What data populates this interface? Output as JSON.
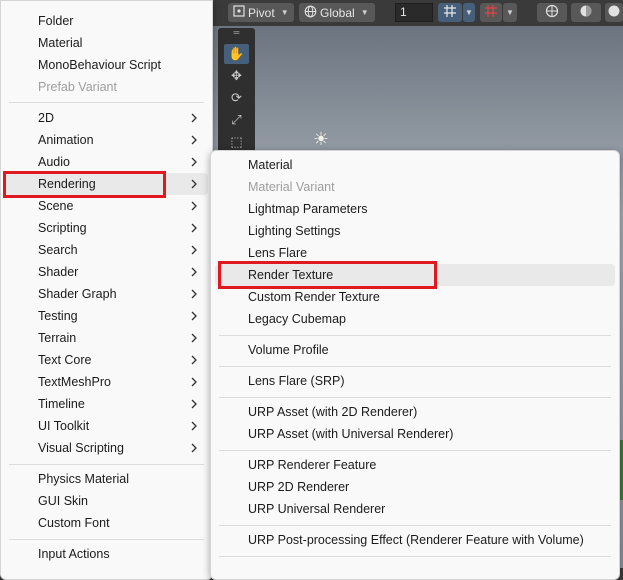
{
  "toolbar": {
    "pivot_label": "Pivot",
    "global_label": "Global",
    "snap_value": "1"
  },
  "main_menu": {
    "items": [
      {
        "label": "Folder",
        "has_submenu": false,
        "enabled": true
      },
      {
        "label": "Material",
        "has_submenu": false,
        "enabled": true
      },
      {
        "label": "MonoBehaviour Script",
        "has_submenu": false,
        "enabled": true
      },
      {
        "label": "Prefab Variant",
        "has_submenu": false,
        "enabled": false
      },
      {
        "label": "2D",
        "has_submenu": true,
        "enabled": true
      },
      {
        "label": "Animation",
        "has_submenu": true,
        "enabled": true
      },
      {
        "label": "Audio",
        "has_submenu": true,
        "enabled": true
      },
      {
        "label": "Rendering",
        "has_submenu": true,
        "enabled": true,
        "state": "highlighted"
      },
      {
        "label": "Scene",
        "has_submenu": true,
        "enabled": true
      },
      {
        "label": "Scripting",
        "has_submenu": true,
        "enabled": true
      },
      {
        "label": "Search",
        "has_submenu": true,
        "enabled": true
      },
      {
        "label": "Shader",
        "has_submenu": true,
        "enabled": true
      },
      {
        "label": "Shader Graph",
        "has_submenu": true,
        "enabled": true
      },
      {
        "label": "Testing",
        "has_submenu": true,
        "enabled": true
      },
      {
        "label": "Terrain",
        "has_submenu": true,
        "enabled": true
      },
      {
        "label": "Text Core",
        "has_submenu": true,
        "enabled": true
      },
      {
        "label": "TextMeshPro",
        "has_submenu": true,
        "enabled": true
      },
      {
        "label": "Timeline",
        "has_submenu": true,
        "enabled": true
      },
      {
        "label": "UI Toolkit",
        "has_submenu": true,
        "enabled": true
      },
      {
        "label": "Visual Scripting",
        "has_submenu": true,
        "enabled": true
      },
      {
        "label": "Physics Material",
        "has_submenu": false,
        "enabled": true
      },
      {
        "label": "GUI Skin",
        "has_submenu": false,
        "enabled": true
      },
      {
        "label": "Custom Font",
        "has_submenu": false,
        "enabled": true
      },
      {
        "label": "Input Actions",
        "has_submenu": false,
        "enabled": true
      }
    ]
  },
  "rendering_submenu": {
    "items": [
      {
        "label": "Material",
        "enabled": true
      },
      {
        "label": "Material Variant",
        "enabled": false
      },
      {
        "label": "Lightmap Parameters",
        "enabled": true
      },
      {
        "label": "Lighting Settings",
        "enabled": true
      },
      {
        "label": "Lens Flare",
        "enabled": true
      },
      {
        "label": "Render Texture",
        "enabled": true,
        "state": "hovered"
      },
      {
        "label": "Custom Render Texture",
        "enabled": true
      },
      {
        "label": "Legacy Cubemap",
        "enabled": true
      },
      {
        "label": "Volume Profile",
        "enabled": true
      },
      {
        "label": "Lens Flare (SRP)",
        "enabled": true
      },
      {
        "label": "URP Asset (with 2D Renderer)",
        "enabled": true
      },
      {
        "label": "URP Asset (with Universal Renderer)",
        "enabled": true
      },
      {
        "label": "URP Renderer Feature",
        "enabled": true
      },
      {
        "label": "URP 2D Renderer",
        "enabled": true
      },
      {
        "label": "URP Universal Renderer",
        "enabled": true
      },
      {
        "label": "URP Post-processing Effect (Renderer Feature with Volume)",
        "enabled": true
      }
    ]
  },
  "colors": {
    "highlight_box": "#e0181f",
    "menu_bg": "#f9f9f9",
    "hover_bg": "#e9e9e9",
    "disabled_text": "#9e9e9e"
  }
}
